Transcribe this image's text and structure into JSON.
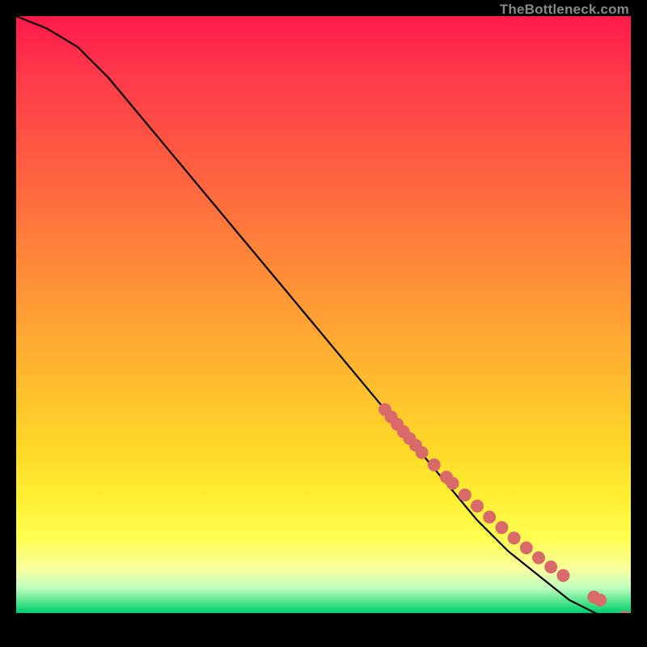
{
  "watermark": "TheBottleneck.com",
  "chart_data": {
    "type": "line",
    "title": "",
    "xlabel": "",
    "ylabel": "",
    "xlim": [
      0,
      100
    ],
    "ylim": [
      0,
      100
    ],
    "curve": {
      "x": [
        0,
        5,
        10,
        15,
        20,
        25,
        30,
        35,
        40,
        45,
        50,
        55,
        60,
        65,
        70,
        75,
        80,
        85,
        90,
        95,
        98,
        100
      ],
      "y": [
        100,
        98,
        95,
        90,
        84,
        78,
        72,
        66,
        60,
        54,
        48,
        42,
        36,
        30,
        24,
        18,
        13,
        9,
        5,
        2.5,
        2,
        2
      ]
    },
    "markers": {
      "x": [
        60,
        61,
        62,
        63,
        64,
        65,
        66,
        68,
        70,
        71,
        73,
        75,
        77,
        79,
        81,
        83,
        85,
        87,
        89,
        94,
        95,
        99,
        100
      ],
      "y": [
        36.0,
        34.8,
        33.6,
        32.4,
        31.3,
        30.2,
        29.0,
        27.0,
        25.0,
        24.0,
        22.1,
        20.3,
        18.5,
        16.8,
        15.1,
        13.5,
        11.9,
        10.4,
        9.0,
        5.5,
        5.0,
        2.2,
        2.0
      ],
      "color": "#d96a6a",
      "size": 8
    }
  }
}
